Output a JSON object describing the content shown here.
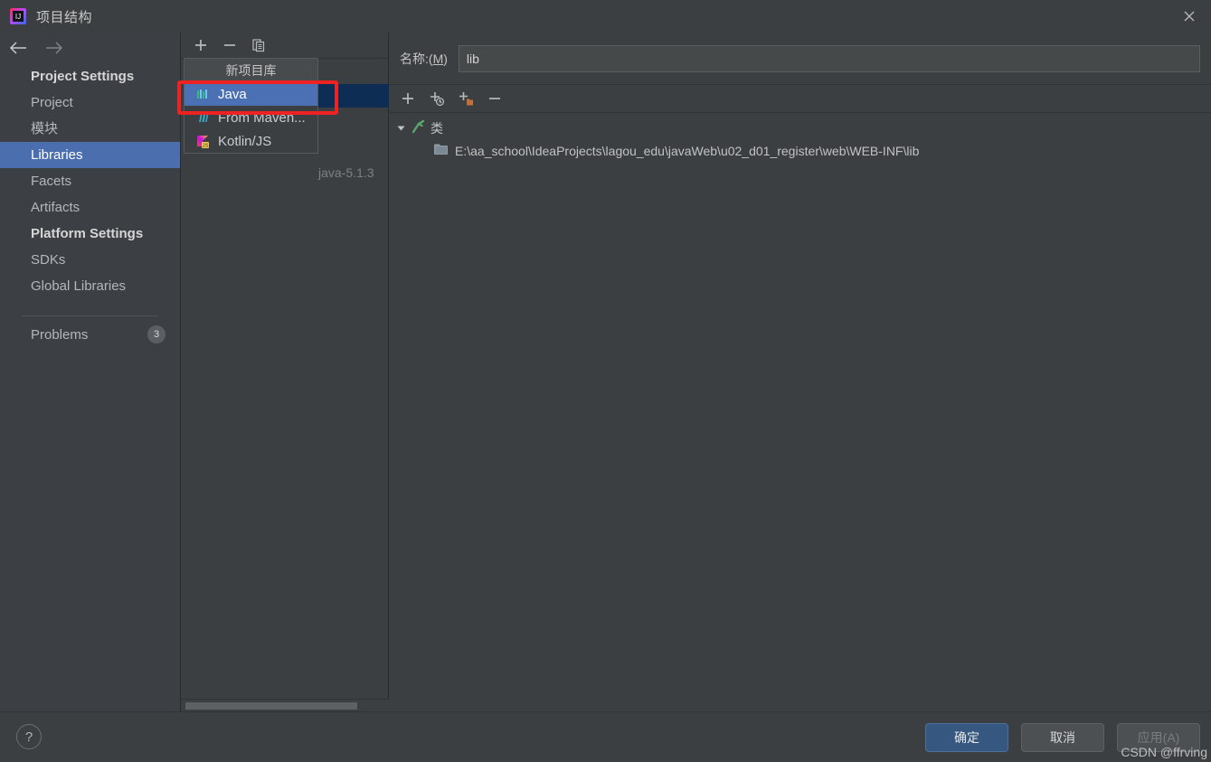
{
  "window": {
    "title": "项目结构",
    "logo_icon": "intellij-idea-logo",
    "close_icon": "close-icon"
  },
  "sidebar": {
    "back_icon": "arrow-left-icon",
    "forward_icon": "arrow-right-icon",
    "groups": [
      {
        "label": "Project Settings",
        "items": [
          {
            "label": "Project",
            "selected": false
          },
          {
            "label": "模块",
            "selected": false
          },
          {
            "label": "Libraries",
            "selected": true
          },
          {
            "label": "Facets",
            "selected": false
          },
          {
            "label": "Artifacts",
            "selected": false
          }
        ]
      },
      {
        "label": "Platform Settings",
        "items": [
          {
            "label": "SDKs",
            "selected": false
          },
          {
            "label": "Global Libraries",
            "selected": false
          }
        ]
      }
    ],
    "problems": {
      "label": "Problems",
      "count": "3"
    }
  },
  "middle_panel": {
    "toolbar": [
      {
        "name": "add-library-button",
        "icon": "plus-icon"
      },
      {
        "name": "remove-library-button",
        "icon": "minus-icon"
      },
      {
        "name": "copy-library-button",
        "icon": "copy-icon"
      }
    ],
    "obscured_row_text": "java-5.1.3"
  },
  "popup_menu": {
    "header": "新项目库",
    "items": [
      {
        "label": "Java",
        "icon": "java-icon",
        "active": true
      },
      {
        "label": "From Maven...",
        "icon": "maven-icon",
        "active": false
      },
      {
        "label": "Kotlin/JS",
        "icon": "kotlin-js-icon",
        "active": false
      }
    ]
  },
  "details": {
    "name_label_prefix": "名称:(",
    "name_label_mnemonic": "M",
    "name_label_suffix": ")",
    "name_value": "lib",
    "name_placeholder": "",
    "toolbar": [
      {
        "name": "add-item-button",
        "icon": "plus-icon"
      },
      {
        "name": "add-sources-button",
        "icon": "plus-clock-icon"
      },
      {
        "name": "add-classes-button",
        "icon": "plus-folder-icon"
      },
      {
        "name": "remove-item-button",
        "icon": "minus-icon"
      }
    ],
    "tree": {
      "root": {
        "label": "类",
        "icon": "classes-root-icon",
        "expanded": true,
        "caret_icon": "caret-down-icon"
      },
      "children": [
        {
          "label": "E:\\aa_school\\IdeaProjects\\lagou_edu\\javaWeb\\u02_d01_register\\web\\WEB-INF\\lib",
          "icon": "archive-folder-icon"
        }
      ]
    }
  },
  "footer": {
    "help_icon": "help-icon",
    "buttons": [
      {
        "label": "确定",
        "style": "primary",
        "name": "ok-button"
      },
      {
        "label": "取消",
        "style": "normal",
        "name": "cancel-button"
      },
      {
        "label": "应用(A)",
        "style": "disabled",
        "name": "apply-button"
      }
    ]
  },
  "watermark": {
    "text": "CSDN @ffrving"
  },
  "colors": {
    "dialog_bg": "#3c3f41",
    "sidebar_bg": "#3c4044",
    "selection_blue": "#4b6eaf",
    "popup_selection": "#4b70b3",
    "highlight_red": "#ee2222",
    "primary_button": "#365880",
    "row_selected_dark": "#0d2d54"
  }
}
